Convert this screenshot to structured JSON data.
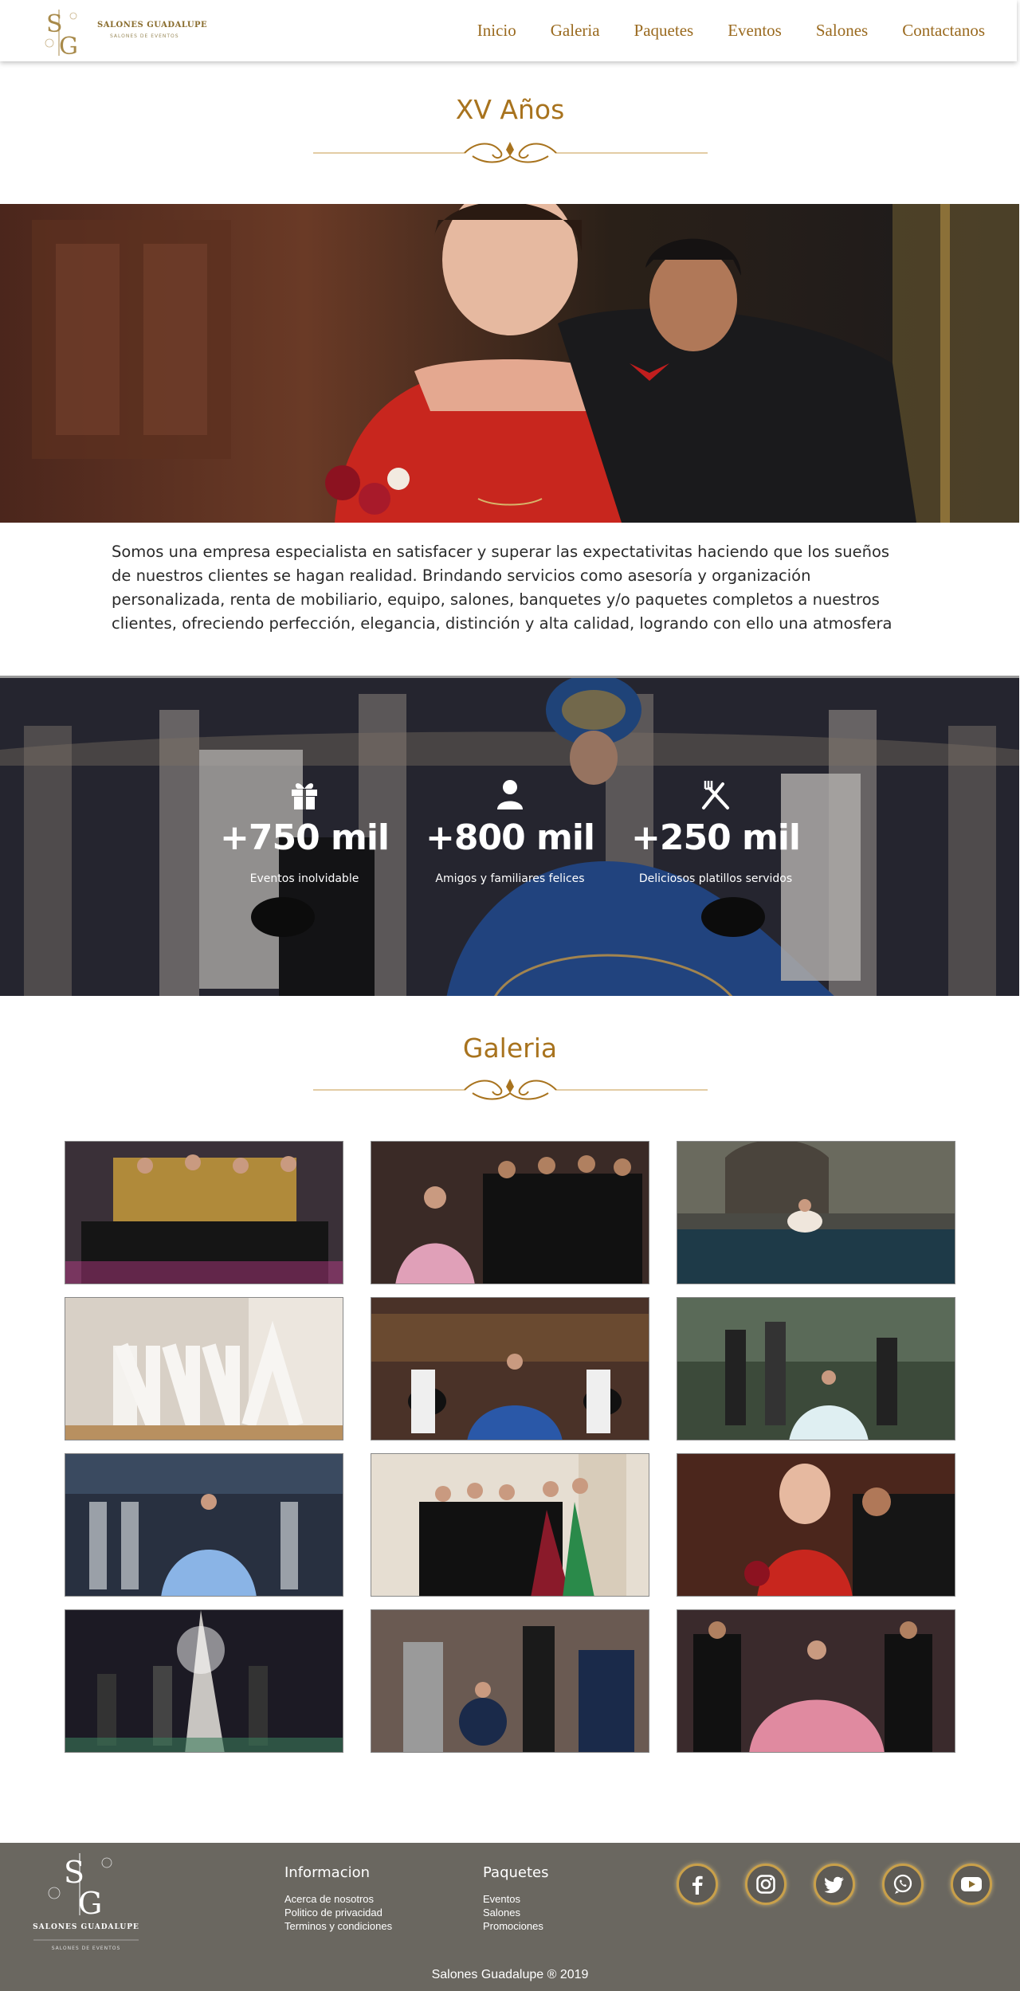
{
  "brand": {
    "name": "SALONES GUADALUPE",
    "tagline": "SALONES DE EVENTOS",
    "monogram": "SG"
  },
  "nav": {
    "items": [
      "Inicio",
      "Galeria",
      "Paquetes",
      "Eventos",
      "Salones",
      "Contactanos"
    ]
  },
  "page": {
    "title": "XV Años"
  },
  "intro": {
    "text": "Somos una empresa especialista en satisfacer y superar las expectativitas haciendo que los  sueños de nuestros clientes se hagan  realidad. Brindando servicios como asesoría y organización personalizada, renta de mobiliario, equipo, salones, banquetes y/o  paquetes completos a nuestros clientes, ofreciendo perfección, elegancia, distinción y alta calidad, logrando  con ello  una  atmosfera"
  },
  "stats": [
    {
      "icon": "gift-icon",
      "value": "+750 mil",
      "label": "Eventos inolvidable"
    },
    {
      "icon": "person-icon",
      "value": "+800 mil",
      "label": "Amigos y familiares felices"
    },
    {
      "icon": "utensils-icon",
      "value": "+250 mil",
      "label": "Deliciosos platillos servidos"
    }
  ],
  "gallery": {
    "title": "Galeria"
  },
  "footer": {
    "brand_name": "SALONES GUADALUPE",
    "brand_sub": "SALONES DE EVENTOS",
    "info": {
      "title": "Informacion",
      "links": [
        "Acerca de nosotros",
        "Politico de privacidad",
        "Terminos y condiciones"
      ]
    },
    "packages": {
      "title": "Paquetes",
      "links": [
        "Eventos",
        "Salones",
        "Promociones"
      ]
    },
    "social": [
      "facebook-icon",
      "instagram-icon",
      "twitter-icon",
      "whatsapp-icon",
      "youtube-icon"
    ],
    "copyright": "Salones Guadalupe ® 2019"
  },
  "colors": {
    "accent": "#a8731e",
    "footer_bg": "#6a6760",
    "social_ring": "#c9a04a"
  }
}
